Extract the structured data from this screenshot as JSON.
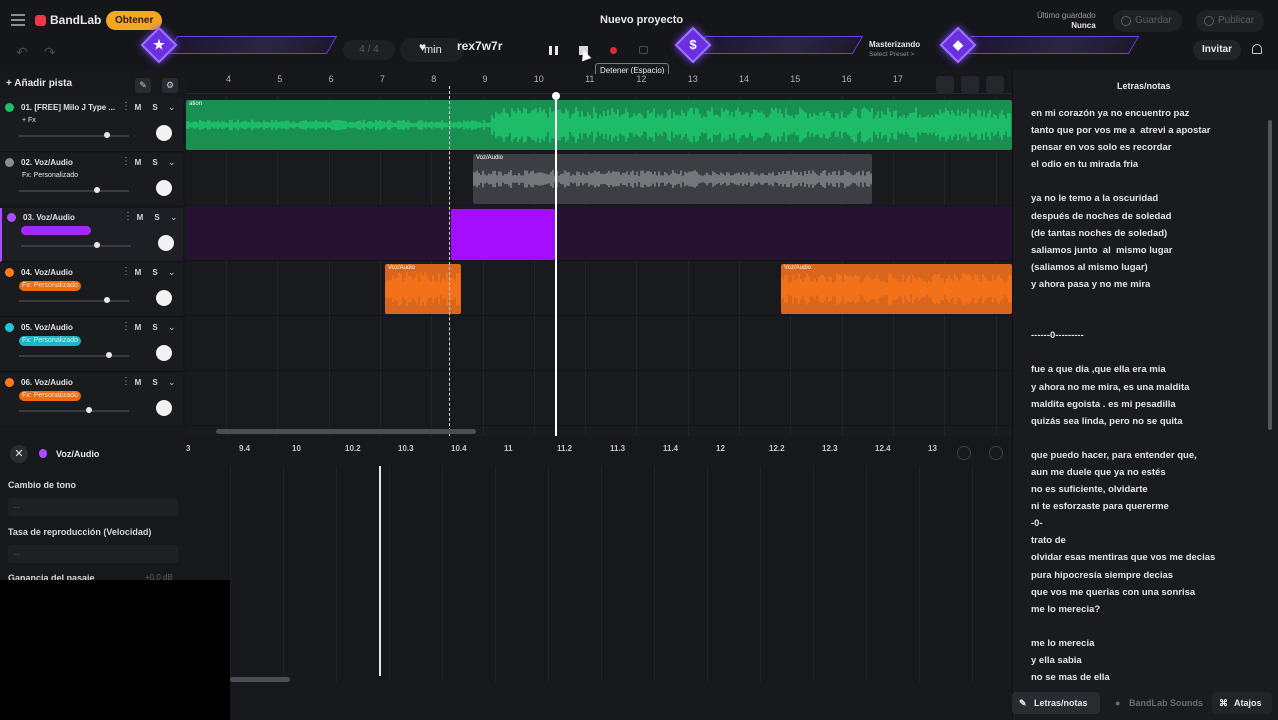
{
  "header": {
    "brand": "BandLab",
    "get_button": "Obtener",
    "project_title": "Nuevo proyecto",
    "saved_label": "Último guardado",
    "saved_value": "Nunca",
    "save_button": "Guardar",
    "publish_button": "Publicar",
    "invite_button": "Invitar"
  },
  "transport": {
    "pager": "4 / 4",
    "unit": "min",
    "user": "rex7w7r",
    "tooltip": "Detener (Espacio)",
    "mastering_label": "Masterizando",
    "mastering_preset": "Select Preset >"
  },
  "tracks_panel": {
    "add_track": "Añadir pista",
    "tracks": [
      {
        "name": "01. [FREE] Milo J Type ...",
        "fx": "+ Fx",
        "color": "#19c16a",
        "fx_color": "transparent"
      },
      {
        "name": "02. Voz/Audio",
        "fx": "Fx: Personalizado",
        "color": "#8c8d92",
        "fx_color": "transparent"
      },
      {
        "name": "03. Voz/Audio",
        "fx": "",
        "color": "#a64fff",
        "fx_color": "#a12bff"
      },
      {
        "name": "04. Voz/Audio",
        "fx": "Fx: Personalizado",
        "color": "#ff7a1a",
        "fx_color": "#f06a10"
      },
      {
        "name": "05. Voz/Audio",
        "fx": "Fx: Personalizado",
        "color": "#22c7d6",
        "fx_color": "#1ab8c7"
      },
      {
        "name": "06. Voz/Audio",
        "fx": "Fx: Personalizado",
        "color": "#ff7a1a",
        "fx_color": "#f06a10"
      }
    ],
    "mute_label": "M",
    "solo_label": "S"
  },
  "timeline": {
    "ruler": [
      "4",
      "5",
      "6",
      "7",
      "8",
      "9",
      "10",
      "11",
      "12",
      "13",
      "14",
      "15",
      "16",
      "17"
    ],
    "clip_green_label": "ation",
    "clip_label": "Voz/Audio"
  },
  "editor": {
    "title": "Voz/Audio",
    "pitch_label": "Cambio de tono",
    "pitch_value": "--",
    "rate_label": "Tasa de reproducción (Velocidad)",
    "rate_value": "--",
    "gain_label": "Ganancia del pasaje",
    "gain_value": "+0.0 dB",
    "ruler": [
      "3",
      "9.4",
      "10",
      "10.2",
      "10.3",
      "10.4",
      "11",
      "11.2",
      "11.3",
      "11.4",
      "12",
      "12.2",
      "12.3",
      "12.4",
      "13"
    ]
  },
  "lyrics": {
    "title": "Letras/notas",
    "text": "en mi corazón ya no encuentro paz\ntanto que por vos me a  atrevi a apostar\npensar en vos solo es recordar\nel odio en tu mirada fria\n\nya no le temo a la oscuridad\ndespués de noches de soledad\n(de tantas noches de soledad)\nsaliamos junto  al  mismo lugar\n(saliamos al mismo lugar)\ny ahora pasa y no me mira\n\n\n------0---------\n\nfue a que dia ,que ella era mia\ny ahora no me mira, es una maldita\nmaldita egoista . es mi pesadilla\nquizás sea linda, pero no se quita\n\nque puedo hacer, para entender que,\naun me duele que ya no estés\nno es suficiente, olvidarte\nni te esforzaste para quererme\n-0-\ntrato de\nolvidar esas mentiras que vos me decias\npura hipocresía siempre decias\nque vos me querias con una sonrisa\nme lo merecia?\n\nme lo merecia\ny ella sabia\nno se mas de ella",
    "tab_lyrics": "Letras/notas",
    "tab_sounds": "BandLab Sounds",
    "tab_shortcuts": "Atajos"
  },
  "colors": {
    "green": "#1ecf72",
    "gray_clip": "#4a4b50",
    "purple": "#a50bff",
    "orange": "#ff7617",
    "hud": "#6f3be8"
  }
}
